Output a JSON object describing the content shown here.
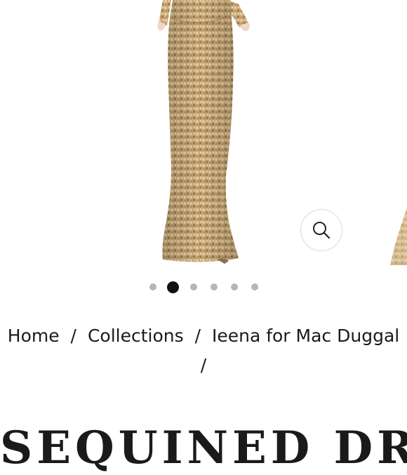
{
  "gallery": {
    "zoom_icon": "search-icon",
    "dot_count": 6,
    "active_dot": 1
  },
  "breadcrumb": {
    "home": "Home",
    "collections": "Collections",
    "brand": "Ieena for Mac Duggal",
    "separator": "/"
  },
  "product": {
    "title": "SEQUINED DRAPED"
  },
  "colors": {
    "dress_gold": "#c9a978",
    "dot_inactive": "#b5b5b5",
    "dot_active": "#111111",
    "text": "#1a1a1a"
  }
}
